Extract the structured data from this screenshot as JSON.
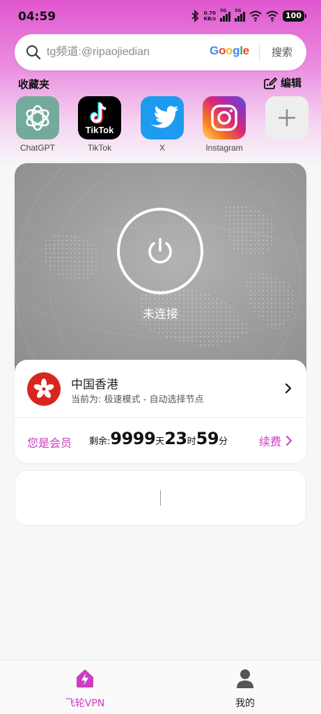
{
  "status_bar": {
    "time": "04:59",
    "net_speed_value": "0.70",
    "net_speed_unit": "KB/s",
    "sim1_tag": "5G",
    "sim2_tag": "5G",
    "battery": "100"
  },
  "search": {
    "placeholder": "tg频道:@ripaojiedian",
    "engine": "Google",
    "button_label": "搜索"
  },
  "favorites": {
    "title": "收藏夹",
    "edit_label": "编辑",
    "items": [
      {
        "label": "ChatGPT",
        "icon": "chatgpt-icon",
        "color": "#74aa9c"
      },
      {
        "label": "TikTok",
        "icon": "tiktok-icon",
        "color": "#000000"
      },
      {
        "label": "X",
        "icon": "twitter-bird-icon",
        "color": "#1d9bf0"
      },
      {
        "label": "Instagram",
        "icon": "instagram-icon",
        "color": "#e1306c"
      },
      {
        "label": "",
        "icon": "plus-icon",
        "color": "#eeeeee"
      }
    ]
  },
  "vpn": {
    "status": "未连接",
    "region": "中国香港",
    "mode": "当前为: 极速模式 - 自动选择节点",
    "member_label": "您是会员",
    "remaining": {
      "prefix": "剩余:",
      "days": "9999",
      "days_unit": "天",
      "hours": "23",
      "hours_unit": "时",
      "minutes": "59",
      "minutes_unit": "分"
    },
    "renew_label": "续费"
  },
  "nav": {
    "items": [
      {
        "label": "飞轮VPN",
        "icon": "home-icon",
        "active": true
      },
      {
        "label": "我的",
        "icon": "person-icon",
        "active": false
      }
    ]
  },
  "colors": {
    "accent": "#c93ec2",
    "header_gradient_top": "#e056cf",
    "flag_red": "#d9261c"
  }
}
